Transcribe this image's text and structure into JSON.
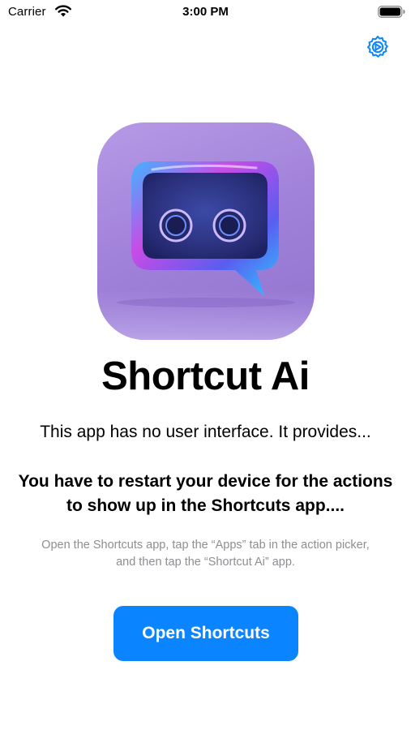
{
  "status_bar": {
    "carrier": "Carrier",
    "time": "3:00 PM",
    "wifi_icon": "wifi-icon",
    "battery_icon": "battery-full-icon"
  },
  "toolbar": {
    "settings_icon": "gear-icon"
  },
  "app": {
    "icon": "chat-bubble-robot-icon",
    "title": "Shortcut Ai",
    "subtitle": "This app has no user interface. It provides...",
    "restart_note": "You have to restart your device for the actions to show up in the Shortcuts app....",
    "hint": "Open the Shortcuts app, tap the “Apps” tab in the action picker, and then tap the “Shortcut Ai” app."
  },
  "actions": {
    "open_label": "Open Shortcuts"
  },
  "colors": {
    "accent": "#0a84ff",
    "hint_text": "#8e8e93",
    "background": "#ffffff"
  }
}
